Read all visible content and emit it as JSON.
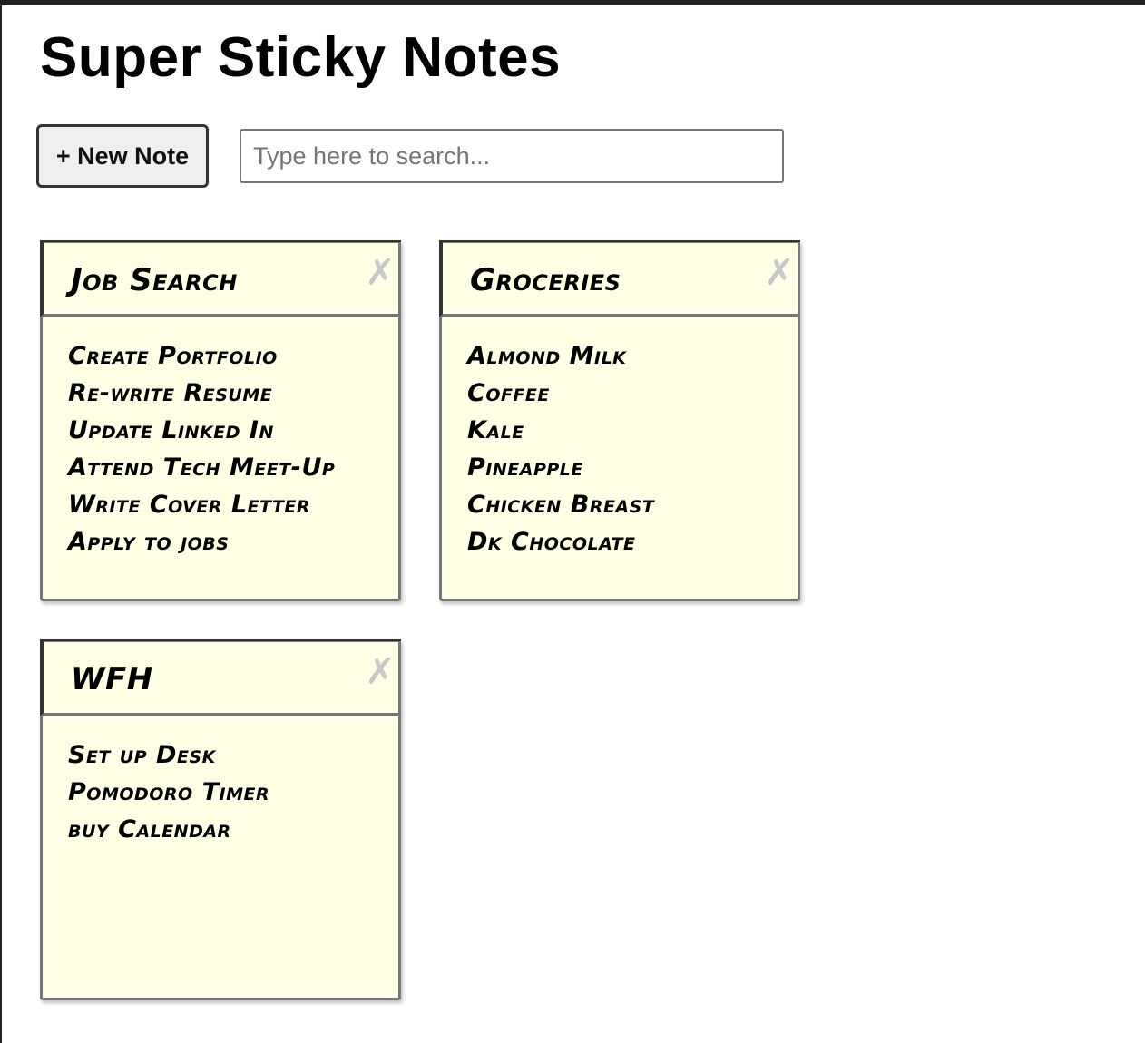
{
  "app": {
    "title": "Super Sticky Notes"
  },
  "toolbar": {
    "new_note_label": "+ New Note",
    "search_placeholder": "Type here to search...",
    "search_value": ""
  },
  "icons": {
    "close": "close-icon"
  },
  "colors": {
    "note_background": "#ffffe6",
    "note_border": "#777777",
    "close_icon": "#c8c8c8"
  },
  "notes": [
    {
      "title": "Job Search",
      "close_glyph": "✗",
      "lines": [
        "Create Portfolio",
        "Re-write Resume",
        "Update Linked In",
        "Attend Tech Meet-Up",
        "Write Cover Letter",
        "Apply to jobs"
      ]
    },
    {
      "title": "Groceries",
      "close_glyph": "✗",
      "lines": [
        "Almond Milk",
        "Coffee",
        "Kale",
        "Pineapple",
        "Chicken Breast",
        "Dk Chocolate"
      ]
    },
    {
      "title": "WFH",
      "close_glyph": "✗",
      "lines": [
        "Set up Desk",
        "Pomodoro Timer",
        "buy Calendar"
      ]
    }
  ]
}
